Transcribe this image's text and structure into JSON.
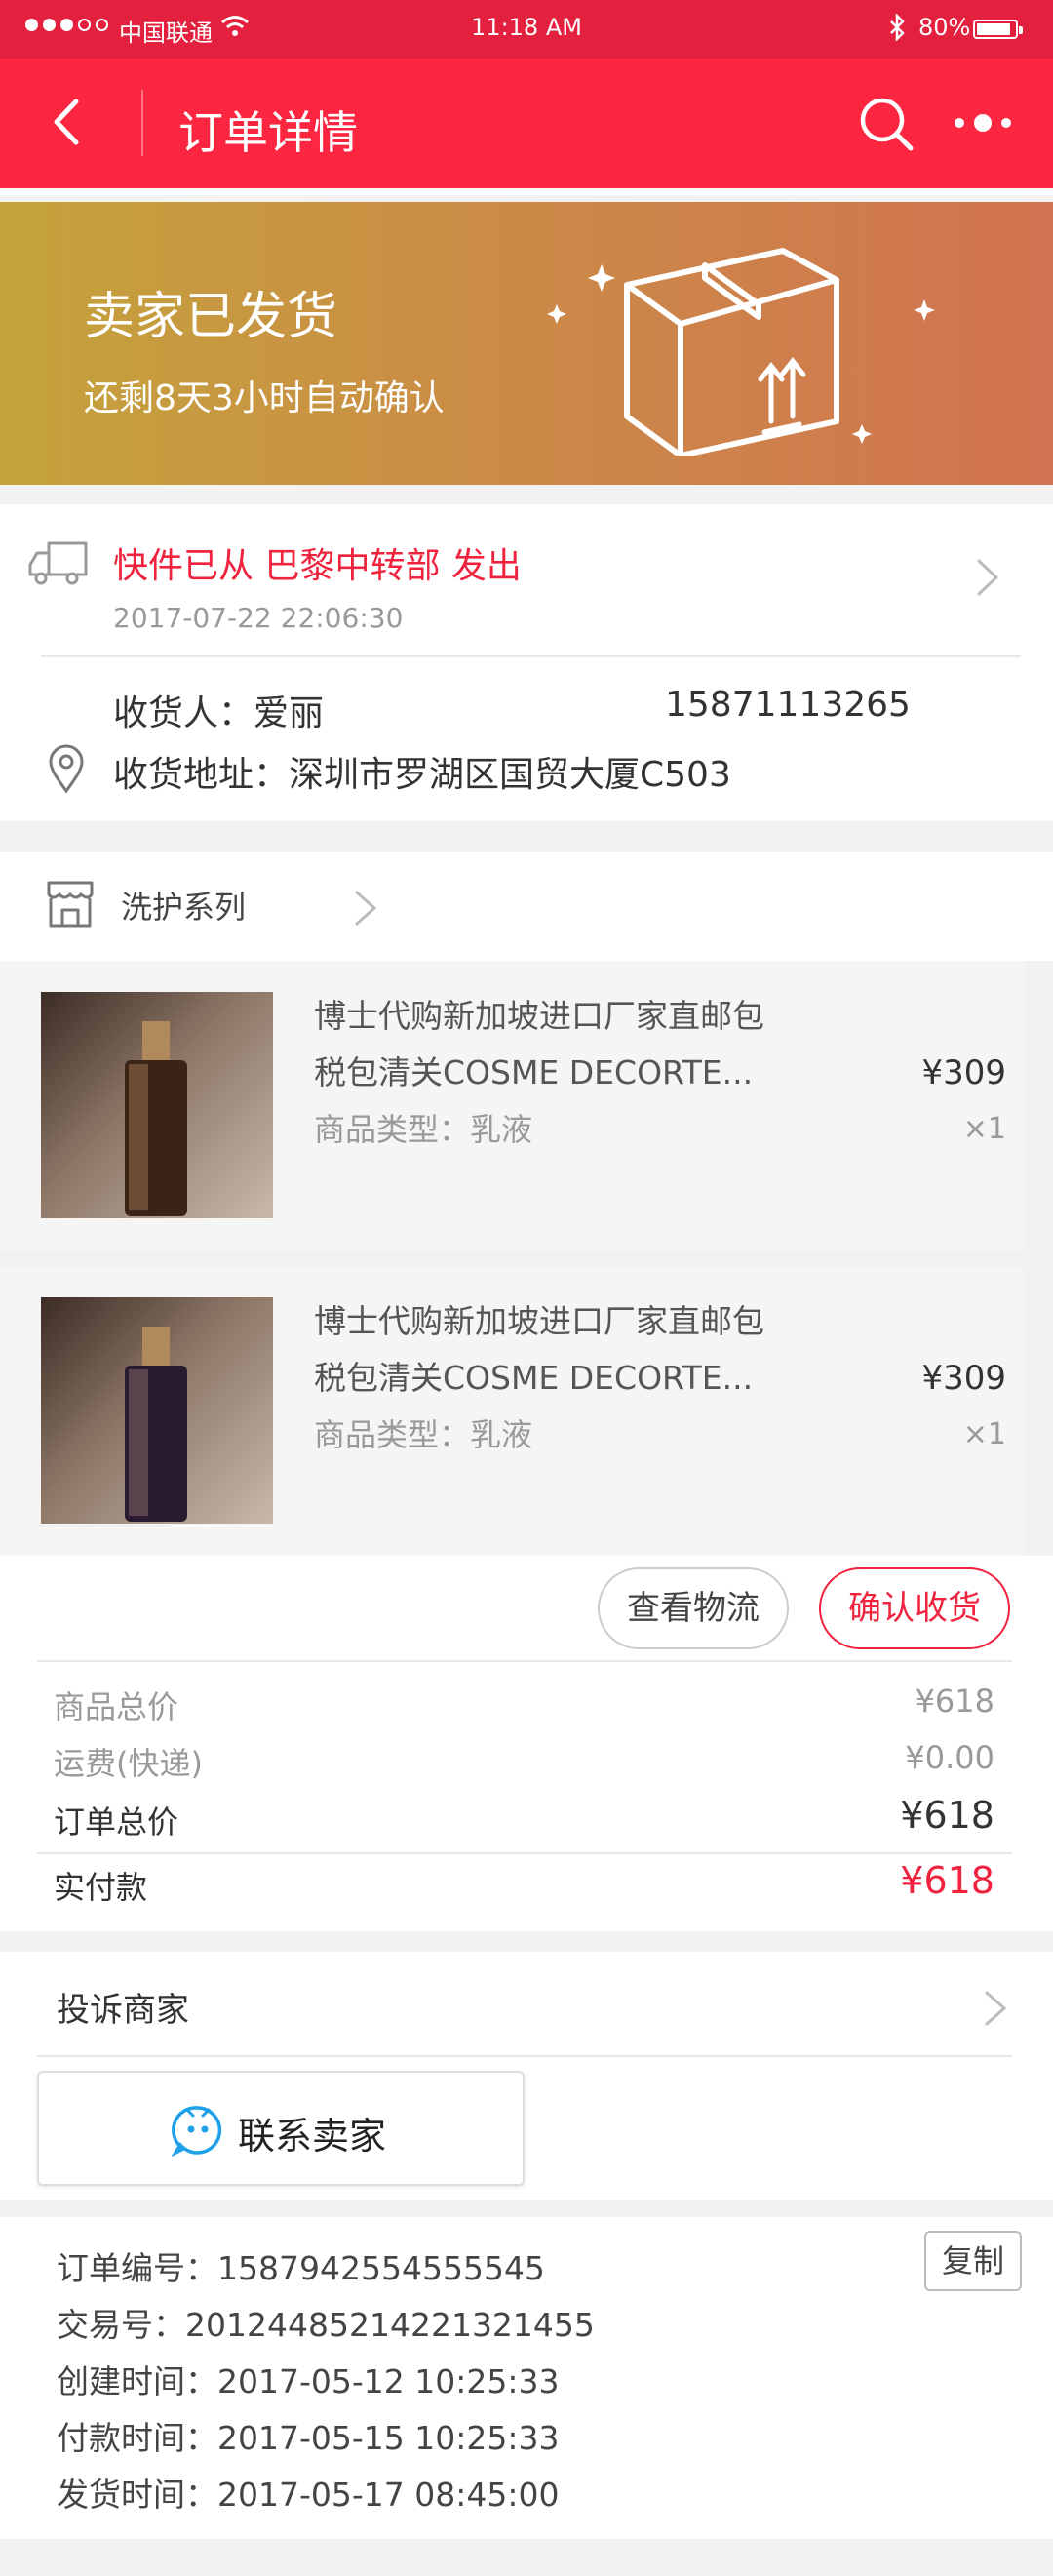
{
  "status_bar": {
    "carrier": "中国联通",
    "time": "11:18 AM",
    "battery": "80%"
  },
  "nav": {
    "title": "订单详情",
    "icons": [
      "back-icon",
      "search-icon",
      "more-icon"
    ]
  },
  "banner": {
    "status": "卖家已发货",
    "countdown": "还剩8天3小时自动确认"
  },
  "shipping": {
    "track_text": "快件已从 巴黎中转部 发出",
    "track_time": "2017-07-22 22:06:30",
    "receiver": "收货人：爱丽",
    "phone": "15871113265",
    "address": "收货地址：深圳市罗湖区国贸大厦C503"
  },
  "shop": {
    "name": "洗护系列"
  },
  "products": [
    {
      "title_line1": "博士代购新加坡进口厂家直邮包",
      "title_line2": "税包清关COSME DECORTE...",
      "type": "商品类型：乳液",
      "price": "¥309",
      "qty": "×1"
    },
    {
      "title_line1": "博士代购新加坡进口厂家直邮包",
      "title_line2": "税包清关COSME DECORTE...",
      "type": "商品类型：乳液",
      "price": "¥309",
      "qty": "×1"
    }
  ],
  "actions": {
    "logistics": "查看物流",
    "confirm": "确认收货"
  },
  "summary": {
    "goods_label": "商品总价",
    "goods_value": "¥618",
    "freight_label": "运费(快递)",
    "freight_value": "¥0.00",
    "order_label": "订单总价",
    "order_value": "¥618",
    "paid_label": "实付款",
    "paid_value": "¥618"
  },
  "complain": {
    "label": "投诉商家",
    "contact": "联系卖家"
  },
  "order_info": {
    "order_no": "订单编号：1587942554555545",
    "trade_no": "交易号：20124485214221321455",
    "created": "创建时间：2017-05-12  10:25:33",
    "paid": "付款时间：2017-05-15  10:25:33",
    "shipped": "发货时间：2017-05-17  08:45:00",
    "copy": "复制"
  },
  "colors": {
    "brand_red": "#fd2641",
    "accent_red": "#f0233f",
    "banner_start": "#c4a33b",
    "banner_end": "#d27351"
  }
}
